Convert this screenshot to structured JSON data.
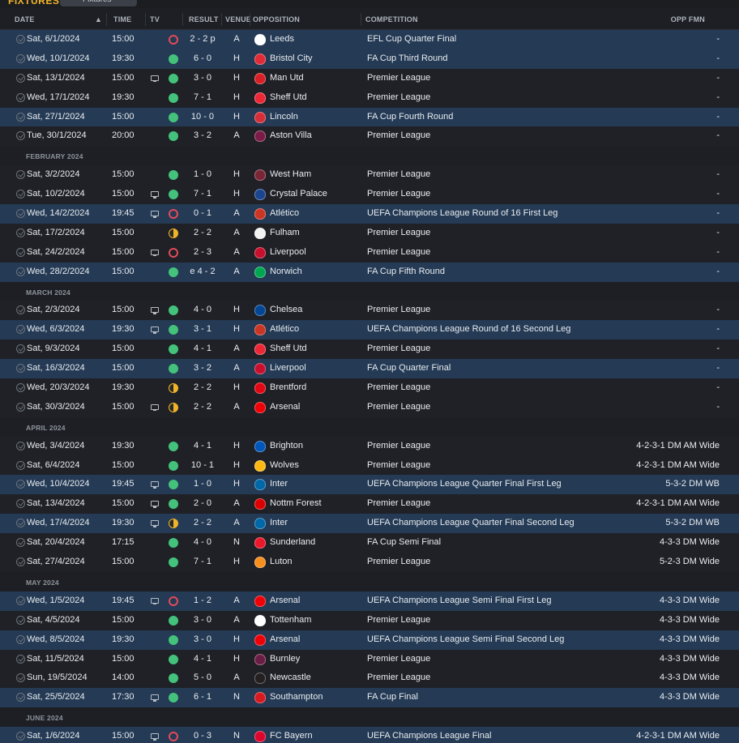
{
  "header": {
    "title": "FIXTURES",
    "dropdown": "Fixtures",
    "cols": {
      "date": "DATE",
      "time": "TIME",
      "tv": "TV",
      "result": "RESULT",
      "venue": "VENUE",
      "opposition": "OPPOSITION",
      "competition": "COMPETITION",
      "fmn": "OPP FMN"
    }
  },
  "rows": [
    {
      "type": "fx",
      "hl": true,
      "date": "Sat, 6/1/2024",
      "time": "15:00",
      "tv": false,
      "res": "loss",
      "score": "2 - 2 p",
      "venue": "A",
      "opp": "Leeds",
      "crest": "#ffffff",
      "comp": "EFL Cup Quarter Final",
      "fmn": "-"
    },
    {
      "type": "fx",
      "hl": true,
      "date": "Wed, 10/1/2024",
      "time": "19:30",
      "tv": false,
      "res": "win",
      "score": "6 - 0",
      "venue": "H",
      "opp": "Bristol City",
      "crest": "#e12b37",
      "comp": "FA Cup Third Round",
      "fmn": "-"
    },
    {
      "type": "fx",
      "hl": false,
      "date": "Sat, 13/1/2024",
      "time": "15:00",
      "tv": true,
      "res": "win",
      "score": "3 - 0",
      "venue": "H",
      "opp": "Man Utd",
      "crest": "#d81f26",
      "comp": "Premier League",
      "fmn": "-"
    },
    {
      "type": "fx",
      "hl": false,
      "date": "Wed, 17/1/2024",
      "time": "19:30",
      "tv": false,
      "res": "win",
      "score": "7 - 1",
      "venue": "H",
      "opp": "Sheff Utd",
      "crest": "#ee2737",
      "comp": "Premier League",
      "fmn": "-"
    },
    {
      "type": "fx",
      "hl": true,
      "date": "Sat, 27/1/2024",
      "time": "15:00",
      "tv": false,
      "res": "win",
      "score": "10 - 0",
      "venue": "H",
      "opp": "Lincoln",
      "crest": "#d62e38",
      "comp": "FA Cup Fourth Round",
      "fmn": "-"
    },
    {
      "type": "fx",
      "hl": false,
      "date": "Tue, 30/1/2024",
      "time": "20:00",
      "tv": false,
      "res": "win",
      "score": "3 - 2",
      "venue": "A",
      "opp": "Aston Villa",
      "crest": "#7a1c45",
      "comp": "Premier League",
      "fmn": "-"
    },
    {
      "type": "month",
      "label": "FEBRUARY 2024"
    },
    {
      "type": "fx",
      "hl": false,
      "date": "Sat, 3/2/2024",
      "time": "15:00",
      "tv": false,
      "res": "win",
      "score": "1 - 0",
      "venue": "H",
      "opp": "West Ham",
      "crest": "#7a2636",
      "comp": "Premier League",
      "fmn": "-"
    },
    {
      "type": "fx",
      "hl": false,
      "date": "Sat, 10/2/2024",
      "time": "15:00",
      "tv": true,
      "res": "win",
      "score": "7 - 1",
      "venue": "H",
      "opp": "Crystal Palace",
      "crest": "#1b458f",
      "comp": "Premier League",
      "fmn": "-"
    },
    {
      "type": "fx",
      "hl": true,
      "date": "Wed, 14/2/2024",
      "time": "19:45",
      "tv": true,
      "res": "loss",
      "score": "0 - 1",
      "venue": "A",
      "opp": "Atlético",
      "crest": "#cb3524",
      "comp": "UEFA Champions League Round of 16 First Leg",
      "fmn": "-"
    },
    {
      "type": "fx",
      "hl": false,
      "date": "Sat, 17/2/2024",
      "time": "15:00",
      "tv": false,
      "res": "draw",
      "score": "2 - 2",
      "venue": "A",
      "opp": "Fulham",
      "crest": "#f2f2f2",
      "comp": "Premier League",
      "fmn": "-"
    },
    {
      "type": "fx",
      "hl": false,
      "date": "Sat, 24/2/2024",
      "time": "15:00",
      "tv": true,
      "res": "loss",
      "score": "2 - 3",
      "venue": "A",
      "opp": "Liverpool",
      "crest": "#c8102e",
      "comp": "Premier League",
      "fmn": "-"
    },
    {
      "type": "fx",
      "hl": true,
      "date": "Wed, 28/2/2024",
      "time": "15:00",
      "tv": false,
      "res": "win",
      "score": "e 4 - 2",
      "venue": "A",
      "opp": "Norwich",
      "crest": "#00a650",
      "comp": "FA Cup Fifth Round",
      "fmn": "-"
    },
    {
      "type": "month",
      "label": "MARCH 2024"
    },
    {
      "type": "fx",
      "hl": false,
      "date": "Sat, 2/3/2024",
      "time": "15:00",
      "tv": true,
      "res": "win",
      "score": "4 - 0",
      "venue": "H",
      "opp": "Chelsea",
      "crest": "#034694",
      "comp": "Premier League",
      "fmn": "-"
    },
    {
      "type": "fx",
      "hl": true,
      "date": "Wed, 6/3/2024",
      "time": "19:30",
      "tv": true,
      "res": "win",
      "score": "3 - 1",
      "venue": "H",
      "opp": "Atlético",
      "crest": "#cb3524",
      "comp": "UEFA Champions League Round of 16 Second Leg",
      "fmn": "-"
    },
    {
      "type": "fx",
      "hl": false,
      "date": "Sat, 9/3/2024",
      "time": "15:00",
      "tv": false,
      "res": "win",
      "score": "4 - 1",
      "venue": "A",
      "opp": "Sheff Utd",
      "crest": "#ee2737",
      "comp": "Premier League",
      "fmn": "-"
    },
    {
      "type": "fx",
      "hl": true,
      "date": "Sat, 16/3/2024",
      "time": "15:00",
      "tv": false,
      "res": "win",
      "score": "3 - 2",
      "venue": "A",
      "opp": "Liverpool",
      "crest": "#c8102e",
      "comp": "FA Cup Quarter Final",
      "fmn": "-"
    },
    {
      "type": "fx",
      "hl": false,
      "date": "Wed, 20/3/2024",
      "time": "19:30",
      "tv": false,
      "res": "draw",
      "score": "2 - 2",
      "venue": "H",
      "opp": "Brentford",
      "crest": "#e30613",
      "comp": "Premier League",
      "fmn": "-"
    },
    {
      "type": "fx",
      "hl": false,
      "date": "Sat, 30/3/2024",
      "time": "15:00",
      "tv": true,
      "res": "draw",
      "score": "2 - 2",
      "venue": "A",
      "opp": "Arsenal",
      "crest": "#ef0107",
      "comp": "Premier League",
      "fmn": "-"
    },
    {
      "type": "month",
      "label": "APRIL 2024"
    },
    {
      "type": "fx",
      "hl": false,
      "date": "Wed, 3/4/2024",
      "time": "19:30",
      "tv": false,
      "res": "win",
      "score": "4 - 1",
      "venue": "H",
      "opp": "Brighton",
      "crest": "#0057b8",
      "comp": "Premier League",
      "fmn": "4-2-3-1 DM AM Wide"
    },
    {
      "type": "fx",
      "hl": false,
      "date": "Sat, 6/4/2024",
      "time": "15:00",
      "tv": false,
      "res": "win",
      "score": "10 - 1",
      "venue": "H",
      "opp": "Wolves",
      "crest": "#fdb913",
      "comp": "Premier League",
      "fmn": "4-2-3-1 DM AM Wide"
    },
    {
      "type": "fx",
      "hl": true,
      "date": "Wed, 10/4/2024",
      "time": "19:45",
      "tv": true,
      "res": "win",
      "score": "1 - 0",
      "venue": "H",
      "opp": "Inter",
      "crest": "#0068a8",
      "comp": "UEFA Champions League Quarter Final First Leg",
      "fmn": "5-3-2 DM WB"
    },
    {
      "type": "fx",
      "hl": false,
      "date": "Sat, 13/4/2024",
      "time": "15:00",
      "tv": true,
      "res": "win",
      "score": "2 - 0",
      "venue": "A",
      "opp": "Nottm Forest",
      "crest": "#dd0000",
      "comp": "Premier League",
      "fmn": "4-2-3-1 DM AM Wide"
    },
    {
      "type": "fx",
      "hl": true,
      "date": "Wed, 17/4/2024",
      "time": "19:30",
      "tv": true,
      "res": "draw",
      "score": "2 - 2",
      "venue": "A",
      "opp": "Inter",
      "crest": "#0068a8",
      "comp": "UEFA Champions League Quarter Final Second Leg",
      "fmn": "5-3-2 DM WB"
    },
    {
      "type": "fx",
      "hl": false,
      "date": "Sat, 20/4/2024",
      "time": "17:15",
      "tv": false,
      "res": "win",
      "score": "4 - 0",
      "venue": "N",
      "opp": "Sunderland",
      "crest": "#eb172b",
      "comp": "FA Cup Semi Final",
      "fmn": "4-3-3 DM Wide"
    },
    {
      "type": "fx",
      "hl": false,
      "date": "Sat, 27/4/2024",
      "time": "15:00",
      "tv": false,
      "res": "win",
      "score": "7 - 1",
      "venue": "H",
      "opp": "Luton",
      "crest": "#f78f1e",
      "comp": "Premier League",
      "fmn": "5-2-3 DM Wide"
    },
    {
      "type": "month",
      "label": "MAY 2024"
    },
    {
      "type": "fx",
      "hl": true,
      "date": "Wed, 1/5/2024",
      "time": "19:45",
      "tv": true,
      "res": "loss",
      "score": "1 - 2",
      "venue": "A",
      "opp": "Arsenal",
      "crest": "#ef0107",
      "comp": "UEFA Champions League Semi Final First Leg",
      "fmn": "4-3-3 DM Wide"
    },
    {
      "type": "fx",
      "hl": false,
      "date": "Sat, 4/5/2024",
      "time": "15:00",
      "tv": false,
      "res": "win",
      "score": "3 - 0",
      "venue": "A",
      "opp": "Tottenham",
      "crest": "#ffffff",
      "comp": "Premier League",
      "fmn": "4-3-3 DM Wide"
    },
    {
      "type": "fx",
      "hl": true,
      "date": "Wed, 8/5/2024",
      "time": "19:30",
      "tv": false,
      "res": "win",
      "score": "3 - 0",
      "venue": "H",
      "opp": "Arsenal",
      "crest": "#ef0107",
      "comp": "UEFA Champions League Semi Final Second Leg",
      "fmn": "4-3-3 DM Wide"
    },
    {
      "type": "fx",
      "hl": false,
      "date": "Sat, 11/5/2024",
      "time": "15:00",
      "tv": false,
      "res": "win",
      "score": "4 - 1",
      "venue": "H",
      "opp": "Burnley",
      "crest": "#6c1d45",
      "comp": "Premier League",
      "fmn": "4-3-3 DM Wide"
    },
    {
      "type": "fx",
      "hl": false,
      "date": "Sun, 19/5/2024",
      "time": "14:00",
      "tv": false,
      "res": "win",
      "score": "5 - 0",
      "venue": "A",
      "opp": "Newcastle",
      "crest": "#241f20",
      "comp": "Premier League",
      "fmn": "4-3-3 DM Wide"
    },
    {
      "type": "fx",
      "hl": true,
      "date": "Sat, 25/5/2024",
      "time": "17:30",
      "tv": true,
      "res": "win",
      "score": "6 - 1",
      "venue": "N",
      "opp": "Southampton",
      "crest": "#d71920",
      "comp": "FA Cup Final",
      "fmn": "4-3-3 DM Wide"
    },
    {
      "type": "month",
      "label": "JUNE 2024"
    },
    {
      "type": "fx",
      "hl": true,
      "date": "Sat, 1/6/2024",
      "time": "15:00",
      "tv": true,
      "res": "loss",
      "score": "0 - 3",
      "venue": "N",
      "opp": "FC Bayern",
      "crest": "#dc052d",
      "comp": "UEFA Champions League Final",
      "fmn": "4-2-3-1 DM AM Wide"
    }
  ]
}
